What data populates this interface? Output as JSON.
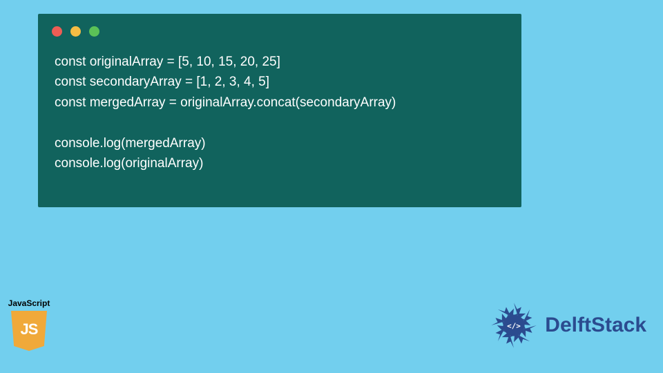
{
  "code": {
    "lines": [
      "const originalArray = [5, 10, 15, 20, 25]",
      "const secondaryArray = [1, 2, 3, 4, 5]",
      "const mergedArray = originalArray.concat(secondaryArray)",
      "",
      "console.log(mergedArray)",
      "console.log(originalArray)"
    ]
  },
  "badges": {
    "js_label": "JavaScript",
    "js_shield_text": "JS",
    "delft_text": "DelftStack",
    "delft_inner": "</>"
  },
  "colors": {
    "page_bg": "#72cfee",
    "window_bg": "#11635d",
    "delft_blue": "#2b4b8f",
    "js_orange": "#f0a93a"
  }
}
